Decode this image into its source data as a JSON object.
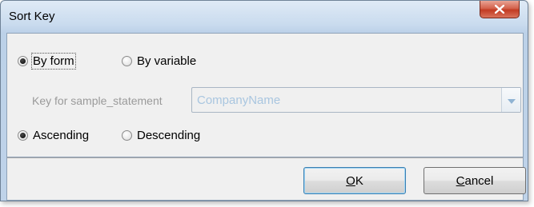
{
  "window": {
    "title": "Sort Key"
  },
  "sort_by": {
    "options": [
      {
        "label": "By form",
        "selected": true
      },
      {
        "label": "By variable",
        "selected": false
      }
    ]
  },
  "key": {
    "label": "Key for sample_statement",
    "value": "CompanyName",
    "enabled": false
  },
  "order": {
    "options": [
      {
        "label": "Ascending",
        "selected": true
      },
      {
        "label": "Descending",
        "selected": false
      }
    ]
  },
  "buttons": {
    "ok": {
      "mnemonic": "O",
      "rest": "K"
    },
    "cancel": {
      "mnemonic": "C",
      "rest": "ancel"
    }
  },
  "icons": {
    "close": "close-icon",
    "dropdown": "chevron-down-icon"
  }
}
